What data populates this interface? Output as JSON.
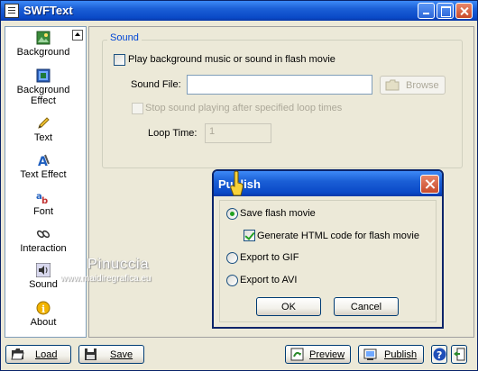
{
  "window": {
    "title": "SWFText"
  },
  "sidebar": {
    "items": [
      {
        "label": "Background",
        "icon": "background-icon"
      },
      {
        "label": "Background Effect",
        "icon": "background-effect-icon"
      },
      {
        "label": "Text",
        "icon": "pencil-icon"
      },
      {
        "label": "Text Effect",
        "icon": "text-effect-icon"
      },
      {
        "label": "Font",
        "icon": "font-icon"
      },
      {
        "label": "Interaction",
        "icon": "interaction-icon"
      },
      {
        "label": "Sound",
        "icon": "speaker-icon"
      },
      {
        "label": "About",
        "icon": "info-icon"
      }
    ]
  },
  "sound": {
    "legend": "Sound",
    "play_label": "Play background music or sound in flash movie",
    "play_checked": false,
    "file_label": "Sound File:",
    "file_value": "",
    "browse_label": "Browse",
    "stop_label": "Stop sound playing after specified loop times",
    "loop_label": "Loop Time:",
    "loop_value": "1"
  },
  "bottombar": {
    "load_label": "Load",
    "save_label": "Save",
    "preview_label": "Preview",
    "publish_label": "Publish"
  },
  "publish_dialog": {
    "title": "Publish",
    "options": [
      {
        "label": "Save flash movie",
        "checked": true
      },
      {
        "label": "Export to GIF",
        "checked": false
      },
      {
        "label": "Export to AVI",
        "checked": false
      }
    ],
    "generate_html_label": "Generate HTML code for flash movie",
    "generate_html_checked": true,
    "ok_label": "OK",
    "cancel_label": "Cancel"
  },
  "watermark": {
    "name": "Pinuccia",
    "url": "www.maidiregrafica.eu"
  },
  "colors": {
    "title_blue": "#0a49c7",
    "legend_blue": "#0046d5",
    "check_green": "#21a121"
  }
}
